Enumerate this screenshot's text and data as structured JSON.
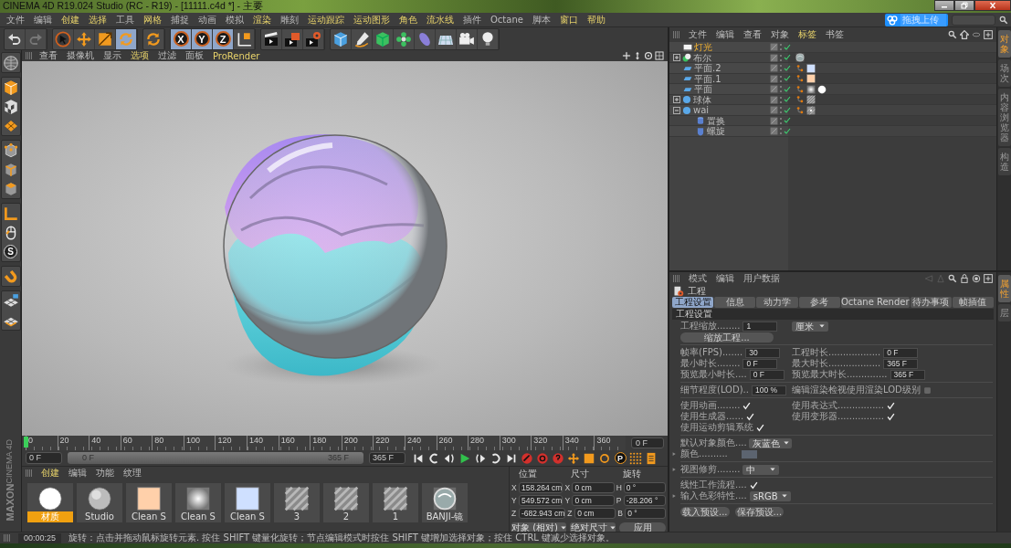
{
  "window": {
    "title": "CINEMA 4D R19.024 Studio (RC - R19) - [11111.c4d *] - 主要"
  },
  "menu": [
    {
      "label": "文件",
      "highlighted": false
    },
    {
      "label": "编辑",
      "highlighted": false
    },
    {
      "label": "创建",
      "highlighted": true
    },
    {
      "label": "选择",
      "highlighted": true
    },
    {
      "label": "工具",
      "highlighted": false
    },
    {
      "label": "网格",
      "highlighted": true
    },
    {
      "label": "捕捉",
      "highlighted": false
    },
    {
      "label": "动画",
      "highlighted": false
    },
    {
      "label": "模拟",
      "highlighted": false
    },
    {
      "label": "渲染",
      "highlighted": true
    },
    {
      "label": "雕刻",
      "highlighted": false
    },
    {
      "label": "运动跟踪",
      "highlighted": true
    },
    {
      "label": "运动图形",
      "highlighted": true
    },
    {
      "label": "角色",
      "highlighted": true
    },
    {
      "label": "流水线",
      "highlighted": true
    },
    {
      "label": "插件",
      "highlighted": false
    },
    {
      "label": "Octane",
      "highlighted": false
    },
    {
      "label": "脚本",
      "highlighted": false
    },
    {
      "label": "窗口",
      "highlighted": true
    },
    {
      "label": "帮助",
      "highlighted": true
    }
  ],
  "upload_badge": "拖拽上传",
  "toolbar": [
    [
      {
        "kind": "undo",
        "selected": false
      },
      {
        "kind": "redo",
        "selected": false
      }
    ],
    [
      {
        "kind": "select",
        "selected": false
      },
      {
        "kind": "move",
        "selected": false
      },
      {
        "kind": "scale",
        "selected": false
      },
      {
        "kind": "rotate",
        "selected": true
      }
    ],
    [
      {
        "kind": "recent",
        "selected": false
      }
    ],
    [
      {
        "kind": "axis",
        "label": "X",
        "selected": true
      },
      {
        "kind": "axis",
        "label": "Y",
        "selected": true
      },
      {
        "kind": "axis",
        "label": "Z",
        "selected": true
      },
      {
        "kind": "coord",
        "selected": false
      }
    ],
    [
      {
        "kind": "render-view",
        "selected": false
      },
      {
        "kind": "render-picture",
        "selected": false
      },
      {
        "kind": "render-settings",
        "selected": false
      }
    ],
    [
      {
        "kind": "cube",
        "selected": false
      },
      {
        "kind": "pen",
        "selected": false
      },
      {
        "kind": "subdiv",
        "selected": false
      },
      {
        "kind": "cloner",
        "selected": false
      },
      {
        "kind": "deformer",
        "selected": false
      },
      {
        "kind": "floor",
        "selected": false
      },
      {
        "kind": "camera",
        "selected": false
      },
      {
        "kind": "light",
        "selected": false
      }
    ]
  ],
  "left_toolbar": [
    [
      {
        "kind": "editable",
        "selected": false
      }
    ],
    [
      {
        "kind": "model",
        "selected": false
      },
      {
        "kind": "texture",
        "selected": false
      },
      {
        "kind": "workplane",
        "selected": false
      }
    ],
    [
      {
        "kind": "points",
        "selected": false
      },
      {
        "kind": "edges",
        "selected": false
      },
      {
        "kind": "polygons",
        "selected": false
      }
    ],
    [
      {
        "kind": "axis",
        "selected": false
      },
      {
        "kind": "tweak",
        "selected": false
      },
      {
        "kind": "snap",
        "label": "S",
        "selected": false
      }
    ],
    [
      {
        "kind": "magnet",
        "selected": false
      }
    ],
    [
      {
        "kind": "lock",
        "selected": false
      },
      {
        "kind": "grid",
        "selected": false
      }
    ]
  ],
  "logo": [
    "MAXON",
    "CINEMA 4D"
  ],
  "viewport": {
    "menu": [
      {
        "label": "查看",
        "highlighted": false
      },
      {
        "label": "摄像机",
        "highlighted": false
      },
      {
        "label": "显示",
        "highlighted": false
      },
      {
        "label": "选项",
        "highlighted": true
      },
      {
        "label": "过滤",
        "highlighted": false
      },
      {
        "label": "面板",
        "highlighted": false
      },
      {
        "label": "ProRender",
        "highlighted": true
      }
    ]
  },
  "timeline": {
    "ticks": [
      "0",
      "20",
      "40",
      "60",
      "80",
      "100",
      "120",
      "140",
      "160",
      "180",
      "200",
      "220",
      "240",
      "260",
      "280",
      "300",
      "320",
      "340",
      "360"
    ],
    "playhead": {
      "level": 0
    },
    "current": "0 F"
  },
  "transport": {
    "start": "0 F",
    "range_start": "0 F",
    "range_end": "365 F",
    "range": {
      "level": 1
    },
    "end": "365 F",
    "buttons": [
      {
        "kind": "to-start"
      },
      {
        "kind": "prev-key"
      },
      {
        "kind": "prev-frame"
      },
      {
        "kind": "play"
      },
      {
        "kind": "next-frame"
      },
      {
        "kind": "next-key"
      },
      {
        "kind": "to-end"
      },
      {
        "kind": "record"
      },
      {
        "kind": "autokey"
      },
      {
        "kind": "keyset"
      },
      {
        "kind": "key-move"
      },
      {
        "kind": "key-scale"
      },
      {
        "kind": "key-rotate"
      },
      {
        "kind": "key-param",
        "label": "P"
      },
      {
        "kind": "key-points"
      },
      {
        "kind": "timeline"
      }
    ]
  },
  "materials": {
    "menu": [
      {
        "label": "创建",
        "highlighted": true
      },
      {
        "label": "编辑",
        "highlighted": false
      },
      {
        "label": "功能",
        "highlighted": false
      },
      {
        "label": "纹理",
        "highlighted": false
      }
    ],
    "items": [
      {
        "name": "材质",
        "kind": "sphere",
        "color": "#ffffff",
        "selected": true
      },
      {
        "name": "Studio",
        "kind": "sphere",
        "color": "#bcbcbc",
        "selected": false
      },
      {
        "name": "Clean S",
        "kind": "swatch",
        "color": "#ffd0aa",
        "selected": false
      },
      {
        "name": "Clean S",
        "kind": "soft",
        "selected": false
      },
      {
        "name": "Clean S",
        "kind": "swatch",
        "color": "#cfe0ff",
        "selected": false
      },
      {
        "name": "3",
        "kind": "striped",
        "selected": false
      },
      {
        "name": "2",
        "kind": "striped",
        "selected": false
      },
      {
        "name": "1",
        "kind": "striped",
        "selected": false
      },
      {
        "name": "BANJI-镜",
        "kind": "glass",
        "selected": false
      }
    ]
  },
  "coordinates": {
    "headers": [
      "位置",
      "尺寸",
      "旋转"
    ],
    "rows": [
      {
        "axis": "X",
        "position": "158.264 cm",
        "size_axis": "X",
        "size": "0 cm",
        "rotation_axis": "H",
        "rotation": "0 °"
      },
      {
        "axis": "Y",
        "position": "549.572 cm",
        "size_axis": "Y",
        "size": "0 cm",
        "rotation_axis": "P",
        "rotation": "-28.206 °"
      },
      {
        "axis": "Z",
        "position": "-682.943 cm",
        "size_axis": "Z",
        "size": "0 cm",
        "rotation_axis": "B",
        "rotation": "0 °"
      }
    ],
    "mode": "对象 (相对)",
    "size_mode": "绝对尺寸",
    "apply": "应用"
  },
  "status_bar": {
    "time": "00:00:25",
    "message": "旋转：点击并拖动鼠标旋转元素. 按住 SHIFT 键量化旋转；节点编辑模式时按住 SHIFT 键增加选择对象；按住 CTRL 键减少选择对象。"
  },
  "objects": {
    "menu": [
      {
        "label": "文件",
        "highlighted": false
      },
      {
        "label": "编辑",
        "highlighted": false
      },
      {
        "label": "查看",
        "highlighted": false
      },
      {
        "label": "对象",
        "highlighted": false
      },
      {
        "label": "标签",
        "highlighted": true
      },
      {
        "label": "书签",
        "highlighted": false
      }
    ],
    "items": [
      {
        "name": "灯光",
        "kind": "light",
        "selected": true,
        "enabled": true
      },
      {
        "name": "布尔",
        "kind": "boole",
        "selected": false,
        "expanded": false,
        "enabled": true,
        "tags": [
          {
            "kind": "glass"
          }
        ]
      },
      {
        "name": "平面.2",
        "kind": "plane",
        "selected": false,
        "enabled": true,
        "tags": [
          {
            "kind": "phong"
          },
          {
            "kind": "swatch",
            "color": "#cfe0ff"
          }
        ]
      },
      {
        "name": "平面.1",
        "kind": "plane",
        "selected": false,
        "enabled": true,
        "tags": [
          {
            "kind": "phong"
          },
          {
            "kind": "swatch",
            "color": "#ffd0aa"
          }
        ]
      },
      {
        "name": "平面",
        "kind": "plane",
        "selected": false,
        "enabled": true,
        "tags": [
          {
            "kind": "phong"
          },
          {
            "kind": "soft"
          },
          {
            "kind": "sphere",
            "color": "#ffffff"
          }
        ]
      },
      {
        "name": "球体",
        "kind": "sphere",
        "selected": false,
        "expanded": false,
        "enabled": true,
        "tags": [
          {
            "kind": "phong"
          },
          {
            "kind": "striped"
          }
        ]
      },
      {
        "name": "wai",
        "kind": "sphere",
        "selected": false,
        "expanded": true,
        "enabled": true,
        "tags": [
          {
            "kind": "phong"
          },
          {
            "kind": "glass-striped"
          }
        ],
        "children": [
          {
            "name": "置换",
            "kind": "displacer",
            "selected": false,
            "enabled": true
          },
          {
            "name": "螺旋",
            "kind": "twist",
            "selected": false,
            "enabled": true
          }
        ]
      }
    ]
  },
  "object_side_tabs": [
    {
      "label": "对象",
      "selected": true
    },
    {
      "label": "场次",
      "selected": false
    },
    {
      "label": "内容浏览器",
      "selected": false
    },
    {
      "label": "构造",
      "selected": false
    }
  ],
  "attributes": {
    "menu": [
      {
        "label": "模式",
        "highlighted": false
      },
      {
        "label": "编辑",
        "highlighted": false
      },
      {
        "label": "用户数据",
        "highlighted": false
      }
    ],
    "title": "工程",
    "tabs": [
      {
        "label": "工程设置",
        "selected": true
      },
      {
        "label": "信息",
        "selected": false
      },
      {
        "label": "动力学",
        "selected": false
      },
      {
        "label": "参考",
        "selected": false
      },
      {
        "label": "Octane Render",
        "selected": false
      },
      {
        "label": "待办事项",
        "selected": false
      },
      {
        "label": "帧插值",
        "selected": false
      }
    ],
    "section": "工程设置",
    "rows": [
      {
        "kind": "row",
        "items": [
          {
            "kind": "number",
            "label": "工程缩放........",
            "value": "1"
          },
          {
            "kind": "dropdown",
            "value": "厘米"
          }
        ]
      },
      {
        "kind": "button",
        "label": "缩放工程..."
      },
      {
        "kind": "divider"
      },
      {
        "kind": "row",
        "items": [
          {
            "kind": "number",
            "label": "帧率(FPS).......",
            "value": "30"
          },
          {
            "kind": "number",
            "label": "工程时长..................",
            "value": "0 F"
          }
        ]
      },
      {
        "kind": "row",
        "items": [
          {
            "kind": "number",
            "label": "最小时长........",
            "value": "0 F"
          },
          {
            "kind": "number",
            "label": "最大时长..................",
            "value": "365 F"
          }
        ]
      },
      {
        "kind": "row",
        "items": [
          {
            "kind": "number",
            "label": "预览最小时长....",
            "value": "0 F"
          },
          {
            "kind": "number",
            "label": "预览最大时长..............",
            "value": "365 F"
          }
        ]
      },
      {
        "kind": "divider"
      },
      {
        "kind": "row",
        "items": [
          {
            "kind": "number",
            "label": "细节程度(LOD)..",
            "value": "100 %"
          },
          {
            "kind": "check",
            "label": "编辑渲染检视使用渲染LOD级别",
            "checked": false
          }
        ]
      },
      {
        "kind": "divider"
      },
      {
        "kind": "row",
        "items": [
          {
            "kind": "check",
            "label": "使用动画........",
            "checked": true
          },
          {
            "kind": "check",
            "label": "使用表达式................",
            "checked": true
          }
        ]
      },
      {
        "kind": "row",
        "items": [
          {
            "kind": "check",
            "label": "使用生成器......",
            "checked": true
          },
          {
            "kind": "check",
            "label": "使用变形器................",
            "checked": true
          }
        ]
      },
      {
        "kind": "row",
        "items": [
          {
            "kind": "check",
            "label": "使用运动剪辑系统",
            "checked": true
          }
        ]
      },
      {
        "kind": "divider"
      },
      {
        "kind": "row",
        "items": [
          {
            "kind": "dropdown",
            "label": "默认对象颜色....",
            "value": "灰蓝色"
          }
        ]
      },
      {
        "kind": "row",
        "items": [
          {
            "kind": "color",
            "label": "颜色..........",
            "color": "#5c6470",
            "expanded": false
          }
        ]
      },
      {
        "kind": "divider"
      },
      {
        "kind": "row",
        "items": [
          {
            "kind": "dropdown",
            "label": "视图修剪........",
            "value": "中",
            "expanded": false
          }
        ]
      },
      {
        "kind": "divider"
      },
      {
        "kind": "row",
        "items": [
          {
            "kind": "check",
            "label": "线性工作流程....",
            "checked": true
          }
        ]
      },
      {
        "kind": "row",
        "items": [
          {
            "kind": "dropdown",
            "label": "输入色彩特性....",
            "value": "sRGB",
            "expanded": false
          }
        ]
      },
      {
        "kind": "divider"
      },
      {
        "kind": "buttons",
        "labels": [
          "载入预设...",
          "保存预设..."
        ]
      }
    ]
  },
  "attribute_side_tabs": [
    {
      "label": "属性",
      "selected": true
    },
    {
      "label": "层",
      "selected": false
    }
  ]
}
